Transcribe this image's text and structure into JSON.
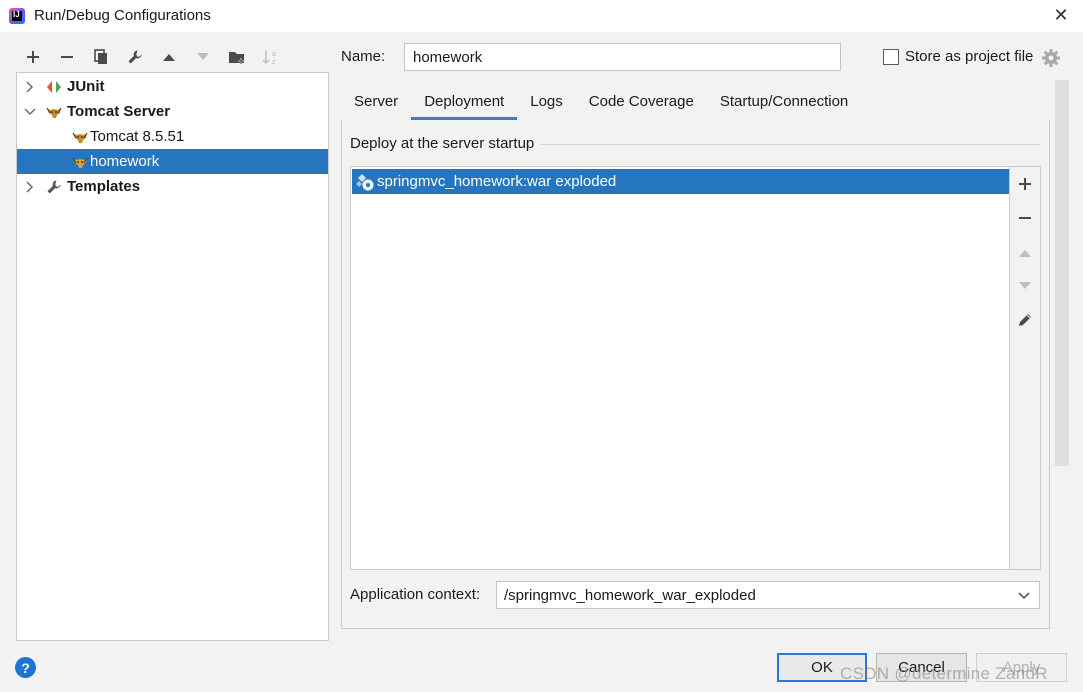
{
  "window": {
    "title": "Run/Debug Configurations",
    "close_glyph": "✕"
  },
  "toolbar": {
    "items": [
      "add-icon",
      "remove-icon",
      "copy-icon",
      "wrench-icon",
      "move-up-icon",
      "move-down-icon",
      "new-folder-icon",
      "sort-icon"
    ]
  },
  "tree": {
    "items": [
      {
        "label": "JUnit",
        "icon": "junit-icon",
        "bold": true,
        "expanded": false
      },
      {
        "label": "Tomcat Server",
        "icon": "tomcat-icon",
        "bold": true,
        "expanded": true
      },
      {
        "label": "Tomcat 8.5.51",
        "icon": "tomcat-icon",
        "bold": false
      },
      {
        "label": "homework",
        "icon": "tomcat-icon",
        "bold": false,
        "selected": true
      },
      {
        "label": "Templates",
        "icon": "wrench-icon",
        "bold": true,
        "expanded": false
      }
    ]
  },
  "name": {
    "label": "Name:",
    "value": "homework"
  },
  "store": {
    "label": "Store as project file",
    "checked": false
  },
  "tabs": [
    {
      "label": "Server",
      "active": false
    },
    {
      "label": "Deployment",
      "active": true
    },
    {
      "label": "Logs",
      "active": false
    },
    {
      "label": "Code Coverage",
      "active": false
    },
    {
      "label": "Startup/Connection",
      "active": false
    }
  ],
  "deployment": {
    "section_title": "Deploy at the server startup",
    "items": [
      {
        "label": "springmvc_homework:war exploded",
        "icon": "artifact-icon",
        "selected": true
      }
    ],
    "side_tools": [
      "add-icon",
      "remove-icon",
      "move-up-icon",
      "move-down-icon",
      "edit-icon"
    ]
  },
  "app_context": {
    "label": "Application context:",
    "value": "/springmvc_homework_war_exploded"
  },
  "buttons": {
    "help": "?",
    "ok": "OK",
    "cancel": "Cancel",
    "apply": "Apply"
  },
  "watermark": "CSDN @determine  ZandR",
  "colors": {
    "selection": "#2675bf",
    "accent": "#3a7fc1",
    "help": "#1d74d7"
  }
}
